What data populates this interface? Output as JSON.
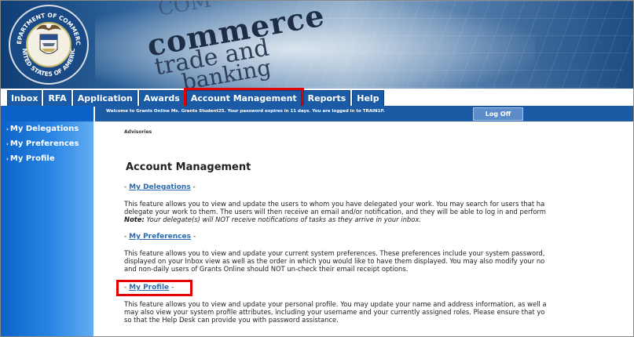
{
  "banner": {
    "seal_text_top": "DEPARTMENT OF COMMERCE",
    "seal_text_bottom": "UNITED STATES OF AMERICA",
    "words": [
      "commerce",
      "trade and",
      "banking"
    ]
  },
  "tabs": [
    {
      "label": "Inbox",
      "highlighted": false
    },
    {
      "label": "RFA",
      "highlighted": false
    },
    {
      "label": "Application",
      "highlighted": false
    },
    {
      "label": "Awards",
      "highlighted": false
    },
    {
      "label": "Account Management",
      "highlighted": true
    },
    {
      "label": "Reports",
      "highlighted": false
    },
    {
      "label": "Help",
      "highlighted": false
    }
  ],
  "infobar": {
    "welcome": "Welcome to Grants Online Ms. Grants Student25. Your password expires in 11 days. You are logged in to TRAIN1P.",
    "logoff": "Log Off"
  },
  "sidebar": {
    "items": [
      "My Delegations",
      "My Preferences",
      "My Profile"
    ]
  },
  "main": {
    "advisories": "Advisories",
    "title": "Account Management",
    "sections": [
      {
        "link": "My Delegations",
        "lines": [
          "This feature allows you to view and update the users to whom you have delegated your work. You may search for users that ha",
          "delegate your work to them. The users will then receive an email and/or notification, and they will be able to log in and perform"
        ],
        "note_label": "Note:",
        "note_text": "Your delegate(s) will NOT receive notifications of tasks as they arrive in your inbox."
      },
      {
        "link": "My Preferences",
        "lines": [
          "This feature allows you to view and update your current system preferences. These preferences include your system password,",
          "displayed on your Inbox view as well as the order in which you would like to have them displayed. You may also modify your no",
          "and non-daily users of Grants Online should NOT un-check their email receipt options."
        ]
      },
      {
        "link": "My Profile",
        "lines": [
          "This feature allows you to view and update your personal profile. You may update your name and address information, as well a",
          "may also view your system profile attributes, including your username and your currently assigned roles. Please ensure that yo",
          "so that the Help Desk can provide you with password assistance."
        ]
      }
    ]
  },
  "colors": {
    "nav_blue": "#1b5aa5",
    "highlight_red": "#e30000",
    "link_blue": "#2a6ab0"
  }
}
